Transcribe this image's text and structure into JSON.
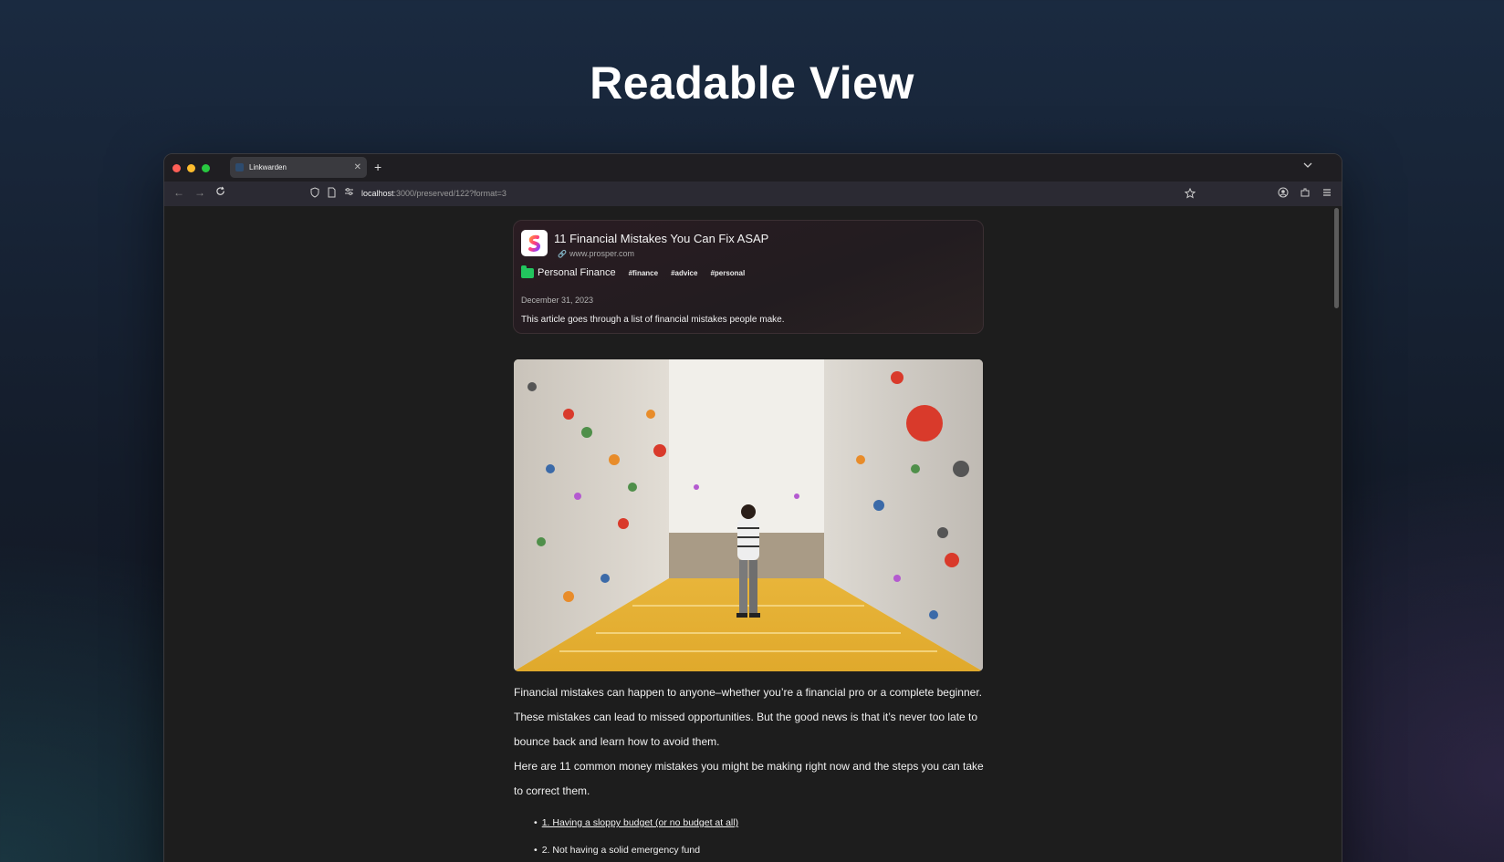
{
  "hero": {
    "title": "Readable View"
  },
  "browser": {
    "tab": {
      "label": "Linkwarden"
    },
    "url": {
      "host": "localhost",
      "path": ":3000/preserved/122?format=3"
    }
  },
  "card": {
    "title": "11 Financial Mistakes You Can Fix ASAP",
    "url": "www.prosper.com",
    "collection": "Personal Finance",
    "tags": [
      "#finance",
      "#advice",
      "#personal"
    ],
    "date": "December 31, 2023",
    "description": "This article goes through a list of financial mistakes people make."
  },
  "article": {
    "paragraphs": [
      "Financial mistakes can happen to anyone–whether you’re a financial pro or a complete beginner. These mistakes can lead to missed opportunities. But the good news is that it’s never too late to bounce back and learn how to avoid them.",
      "Here are 11 common money mistakes you might be making right now and the steps you can take to correct them."
    ],
    "list": [
      "1. Having a sloppy budget (or no budget at all)",
      "2. Not having a solid emergency fund"
    ]
  },
  "colors": {
    "collection_folder": "#22c55e",
    "close_dot": "#fe5f57",
    "minimize_dot": "#febc2e",
    "maximize_dot": "#28c840"
  },
  "icons": [
    "chevron-down-icon",
    "back-arrow-icon",
    "forward-arrow-icon",
    "reload-icon",
    "shield-icon",
    "page-icon",
    "permissions-icon",
    "star-icon",
    "account-icon",
    "extensions-icon",
    "menu-icon",
    "link-icon",
    "folder-icon"
  ]
}
